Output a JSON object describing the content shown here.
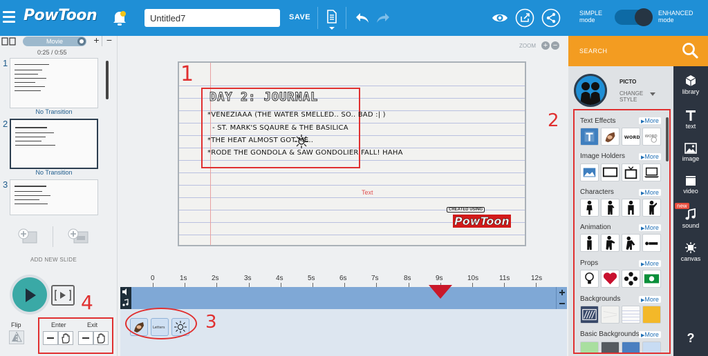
{
  "header": {
    "logo": "PowToon",
    "title_value": "Untitled7",
    "save_label": "SAVE"
  },
  "mode": {
    "simple": "SIMPLE mode",
    "enhanced": "ENHANCED mode"
  },
  "search": {
    "label": "SEARCH"
  },
  "slides_panel": {
    "movie_label": "Movie",
    "time": "0:25 / 0:55",
    "plus": "+",
    "minus": "−",
    "slides": [
      {
        "number": "1"
      },
      {
        "number": "2"
      },
      {
        "number": "3"
      }
    ],
    "transition_label": "No Transition",
    "add_new_slide": "ADD NEW SLIDE"
  },
  "canvas": {
    "zoom_label": "ZOOM",
    "zoom_plus": "+",
    "zoom_minus": "−",
    "journal_title": "DAY 2: JOURNAL",
    "lines": [
      "*VENEZIAAA (THE WATER SMELLED.. SO.. BAD :| )",
      "- ST. MARK'S SQAURE & THE BASILICA",
      "*THE HEAT ALMOST GOT ME..",
      "*RODE THE GONDOLA & SAW GONDOLIER FALL! HAHA"
    ],
    "text_placeholder": "Text",
    "watermark_top": "CREATED USING",
    "watermark_logo": "PowToon"
  },
  "timeline": {
    "ticks": [
      "0",
      "1s",
      "2s",
      "3s",
      "4s",
      "5s",
      "6s",
      "7s",
      "8s",
      "9s",
      "10s",
      "11s",
      "12s"
    ],
    "playhead_seconds": 9,
    "element_thumbs": [
      "hand-drawing",
      "letters",
      "sun"
    ]
  },
  "playback": {
    "flip": "Flip",
    "enter": "Enter",
    "exit": "Exit"
  },
  "library": {
    "character_name": "PICTO",
    "change_style": "CHANGE STYLE",
    "categories": [
      {
        "title": "Text Effects",
        "more": "More"
      },
      {
        "title": "Image Holders",
        "more": "More"
      },
      {
        "title": "Characters",
        "more": "More"
      },
      {
        "title": "Animation",
        "more": "More"
      },
      {
        "title": "Props",
        "more": "More"
      },
      {
        "title": "Backgrounds",
        "more": "More"
      },
      {
        "title": "Basic Backgrounds",
        "more": "More"
      }
    ]
  },
  "side_tabs": [
    {
      "label": "library"
    },
    {
      "label": "text"
    },
    {
      "label": "image"
    },
    {
      "label": "video"
    },
    {
      "label": "sound"
    },
    {
      "label": "canvas"
    },
    {
      "label": "?"
    }
  ],
  "sound_badge": "new",
  "annotations": [
    "1",
    "2",
    "3",
    "4"
  ],
  "colors": {
    "primary_blue": "#1f8fd6",
    "search_orange": "#f39c21",
    "tab_dark": "#2c3440",
    "play_teal": "#3aa9a6",
    "annotation_red": "#e03030",
    "timeline_blue": "#7fa8d6"
  }
}
